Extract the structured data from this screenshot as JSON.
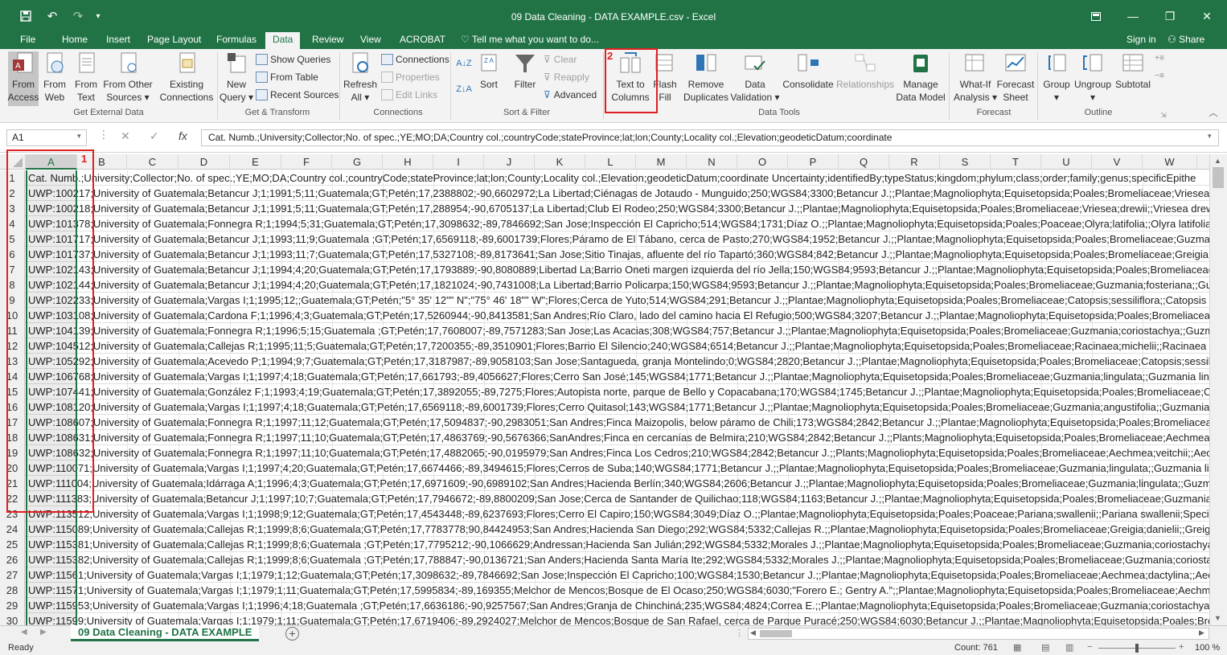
{
  "window": {
    "title": "09 Data Cleaning - DATA EXAMPLE.csv - Excel"
  },
  "tabs": [
    "File",
    "Home",
    "Insert",
    "Page Layout",
    "Formulas",
    "Data",
    "Review",
    "View",
    "ACROBAT"
  ],
  "tell_me": "Tell me what you want to do...",
  "account": {
    "sign_in": "Sign in",
    "share": "Share"
  },
  "ribbon": {
    "get_external": {
      "label": "Get External Data",
      "buttons": [
        [
          "From",
          "Access"
        ],
        [
          "From",
          "Web"
        ],
        [
          "From",
          "Text"
        ],
        [
          "From Other",
          "Sources ▾"
        ],
        [
          "Existing",
          "Connections"
        ]
      ]
    },
    "get_transform": {
      "label": "Get & Transform",
      "new_query": [
        "New",
        "Query ▾"
      ],
      "show_queries": "Show Queries",
      "from_table": "From Table",
      "recent_sources": "Recent Sources"
    },
    "connections": {
      "label": "Connections",
      "refresh": [
        "Refresh",
        "All ▾"
      ],
      "connections": "Connections",
      "properties": "Properties",
      "edit_links": "Edit Links"
    },
    "sort_filter": {
      "label": "Sort & Filter",
      "sort": "Sort",
      "filter": "Filter",
      "clear": "Clear",
      "reapply": "Reapply",
      "advanced": "Advanced"
    },
    "data_tools": {
      "label": "Data Tools",
      "text_to_columns": [
        "Text to",
        "Columns"
      ],
      "flash_fill": [
        "Flash",
        "Fill"
      ],
      "remove_duplicates": [
        "Remove",
        "Duplicates"
      ],
      "data_validation": [
        "Data",
        "Validation ▾"
      ],
      "consolidate": "Consolidate",
      "relationships": "Relationships",
      "manage_data_model": [
        "Manage",
        "Data Model"
      ]
    },
    "forecast": {
      "label": "Forecast",
      "what_if": [
        "What-If",
        "Analysis ▾"
      ],
      "forecast_sheet": [
        "Forecast",
        "Sheet"
      ]
    },
    "outline": {
      "label": "Outline",
      "group": [
        "Group",
        "▾"
      ],
      "ungroup": [
        "Ungroup",
        "▾"
      ],
      "subtotal": "Subtotal"
    }
  },
  "annotations": {
    "one": "1",
    "two": "2"
  },
  "formula_bar": {
    "name_box": "A1",
    "fx": "fx",
    "content": "Cat. Numb.;University;Collector;No. of spec.;YE;MO;DA;Country col.;countryCode;stateProvince;lat;lon;County;Locality col.;Elevation;geodeticDatum;coordinate"
  },
  "columns": [
    "A",
    "B",
    "C",
    "D",
    "E",
    "F",
    "G",
    "H",
    "I",
    "J",
    "K",
    "L",
    "M",
    "N",
    "O",
    "P",
    "Q",
    "R",
    "S",
    "T",
    "U",
    "V",
    "W"
  ],
  "rows": [
    {
      "n": "1",
      "t": "Cat. Numb.;University;Collector;No. of spec.;YE;MO;DA;Country col.;countryCode;stateProvince;lat;lon;County;Locality col.;Elevation;geodeticDatum;coordinate Uncertainty;identifiedBy;typeStatus;kingdom;phylum;class;order;family;genus;specificEpithe"
    },
    {
      "n": "2",
      "t": "UWP:100217;University of Guatemala;Betancur J;1;1991;5;11;Guatemala;GT;Petén;17,2388802;-90,6602972;La Libertad;Ciénagas de Jotaudo - Munguido;250;WGS84;3300;Betancur J.;;Plantae;Magnoliophyta;Equisetopsida;Poales;Bromeliaceae;Vriesea;d"
    },
    {
      "n": "3",
      "t": "UWP:100218;University of Guatemala;Betancur J;1;1991;5;11;Guatemala;GT;Petén;17,288954;-90,6705137;La Libertad;Club El Rodeo;250;WGS84;3300;Betancur J.;;Plantae;Magnoliophyta;Equisetopsida;Poales;Bromeliaceae;Vriesea;drewii;;Vriesea drewi"
    },
    {
      "n": "4",
      "t": "UWP:101378;University of Guatemala;Fonnegra R;1;1994;5;31;Guatemala;GT;Petén;17,3098632;-89,7846692;San Jose;Inspección El Capricho;514;WGS84;1731;Díaz O.;;Plantae;Magnoliophyta;Equisetopsida;Poales;Poaceae;Olyra;latifolia;;Olyra latifolia;S"
    },
    {
      "n": "5",
      "t": "UWP:101717;University of Guatemala;Betancur J;1;1993;11;9;Guatemala   ;GT;Petén;17,6569118;-89,6001739;Flores;Páramo de El Tábano, cerca de Pasto;270;WGS84;1952;Betancur J.;;Plantae;Magnoliophyta;Equisetopsida;Poales;Bromeliaceae;Guzman"
    },
    {
      "n": "6",
      "t": "UWP:101737;University of Guatemala;Betancur J;1;1993;11;7;Guatemala;GT;Petén;17,5327108;-89,8173641;San Jose;Sitio Tinajas, afluente del río Tapartó;360;WGS84;842;Betancur J.;;Plantae;Magnoliophyta;Equisetopsida;Poales;Bromeliaceae;Greigia;s"
    },
    {
      "n": "7",
      "t": "UWP:102143;University of Guatemala;Betancur J;1;1994;4;20;Guatemala;GT;Petén;17,1793889;-90,8080889;Libertad La;Barrio Oneti margen izquierda del río Jella;150;WGS84;9593;Betancur J.;;Plantae;Magnoliophyta;Equisetopsida;Poales;Bromeliaceae;"
    },
    {
      "n": "8",
      "t": "UWP:102144;University of Guatemala;Betancur J;1;1994;4;20;Guatemala;GT;Petén;17,1821024;-90,7431008;La Libertad;Barrio Policarpa;150;WGS84;9593;Betancur J.;;Plantae;Magnoliophyta;Equisetopsida;Poales;Bromeliaceae;Guzmania;fosteriana;;Guz"
    },
    {
      "n": "9",
      "t": "UWP:102233;University of Guatemala;Vargas I;1;1995;12;;Guatemala;GT;Petén;\"5° 35' 12\"\" N\";\"75° 46' 18\"\" W\";Flores;Cerca de Yuto;514;WGS84;291;Betancur J.;;Plantae;Magnoliophyta;Equisetopsida;Poales;Bromeliaceae;Catopsis;sessiliflora;;Catopsis s"
    },
    {
      "n": "10",
      "t": "UWP:103108;University of Guatemala;Cardona F;1;1996;4;3;Guatemala;GT;Petén;17,5260944;-90,8413581;San Andres;Río Claro, lado del camino hacia El Refugio;500;WGS84;3207;Betancur J.;;Plantae;Magnoliophyta;Equisetopsida;Poales;Bromeliaceae;G"
    },
    {
      "n": "11",
      "t": "UWP:104139;University of Guatemala;Fonnegra R;1;1996;5;15;Guatemala   ;GT;Petén;17,7608007;-89,7571283;San Jose;Las Acacias;308;WGS84;757;Betancur J.;;Plantae;Magnoliophyta;Equisetopsida;Poales;Bromeliaceae;Guzmania;coriostachya;;Guzma"
    },
    {
      "n": "12",
      "t": "UWP:104512;University of Guatemala;Callejas R;1;1995;11;5;Guatemala;GT;Petén;17,7200355;-89,3510901;Flores;Barrio El Silencio;240;WGS84;6514;Betancur J.;;Plantae;Magnoliophyta;Equisetopsida;Poales;Bromeliaceae;Racinaea;michelii;;Racinaea mi"
    },
    {
      "n": "13",
      "t": "UWP:105292;University of Guatemala;Acevedo P;1;1994;9;7;Guatemala;GT;Petén;17,3187987;-89,9058103;San Jose;Santagueda, granja Montelindo;0;WGS84;2820;Betancur J.;;Plantae;Magnoliophyta;Equisetopsida;Poales;Bromeliaceae;Catopsis;sessiliflo"
    },
    {
      "n": "14",
      "t": "UWP:106768;University of Guatemala;Vargas I;1;1997;4;18;Guatemala;GT;Petén;17,661793;-89,4056627;Flores;Cerro San José;145;WGS84;1771;Betancur J.;;Plantae;Magnoliophyta;Equisetopsida;Poales;Bromeliaceae;Guzmania;lingulata;;Guzmania lingu"
    },
    {
      "n": "15",
      "t": "UWP:107441;University of Guatemala;González F;1;1993;4;19;Guatemala;GT;Petén;17,3892055;-89,7275;Flores;Autopista norte, parque de Bello y Copacabana;170;WGS84;1745;Betancur J.;;Plantae;Magnoliophyta;Equisetopsida;Poales;Bromeliaceae;Cat"
    },
    {
      "n": "16",
      "t": "UWP:108120;University of Guatemala;Vargas I;1;1997;4;18;Guatemala;GT;Petén;17,6569118;-89,6001739;Flores;Cerro Quitasol;143;WGS84;1771;Betancur J.;;Plantae;Magnoliophyta;Equisetopsida;Poales;Bromeliaceae;Guzmania;angustifolia;;Guzmania a"
    },
    {
      "n": "17",
      "t": "UWP:108607;University of Guatemala;Fonnegra R;1;1997;11;12;Guatemala;GT;Petén;17,5094837;-90,2983051;San Andres;Finca Maizopolis, below páramo de Chili;173;WGS84;2842;Betancur J.;;Plantae;Magnoliophyta;Equisetopsida;Poales;Bromeliaceae;"
    },
    {
      "n": "18",
      "t": "UWP:108631;University of Guatemala;Fonnegra R;1;1997;11;10;Guatemala;GT;Petén;17,4863769;-90,5676366;SanAndres;Finca en cercanías de Belmira;210;WGS84;2842;Betancur J.;;Plants;Magnoliophyta;Equisetopsida;Poales;Bromeliaceae;Aechmea;ve"
    },
    {
      "n": "19",
      "t": "UWP:108632;University of Guatemala;Fonnegra R;1;1997;11;10;Guatemala;GT;Petén;17,4882065;-90,0195979;San Andres;Finca Los Cedros;210;WGS84;2842;Betancur J.;;Plants;Magnoliophyta;Equisetopsida;Poales;Bromeliaceae;Aechmea;veitchii;;Aechn"
    },
    {
      "n": "20",
      "t": "UWP:110071;University of Guatemala;Vargas I;1;1997;4;20;Guatemala;GT;Petén;17,6674466;-89,3494615;Flores;Cerros de Suba;140;WGS84;1771;Betancur J.;;Plantae;Magnoliophyta;Equisetopsida;Poales;Bromeliaceae;Guzmania;lingulata;;Guzmania ling"
    },
    {
      "n": "21",
      "t": "UWP:111004;University of Guatemala;Idárraga A;1;1996;4;3;Guatemala;GT;Petén;17,6971609;-90,6989102;San Andres;Hacienda Berlín;340;WGS84;2606;Betancur J.;;Plantae;Magnoliophyta;Equisetopsida;Poales;Bromeliaceae;Guzmania;lingulata;;Guzmai"
    },
    {
      "n": "22",
      "t": "UWP:111383;University of Guatemala;Betancur J;1;1997;10;7;Guatemala;GT;Petén;17,7946672;-89,8800209;San Jose;Cerca de Santander de Quilichao;118;WGS84;1163;Betancur J.;;Plantae;Magnoliophyta;Equisetopsida;Poales;Bromeliaceae;Guzmania;g"
    },
    {
      "n": "23",
      "t": "UWP:113512;University of Guatemala;Vargas I;1;1998;9;12;Guatemala;GT;Petén;17,4543448;-89,6237693;Flores;Cerro El Capiro;150;WGS84;3049;Díaz O.;;Plantae;Magnoliophyta;Equisetopsida;Poales;Poaceae;Pariana;swallenii;;Pariana swallenii;Species,"
    },
    {
      "n": "24",
      "t": "UWP:115089;University of Guatemala;Callejas R;1;1999;8;6;Guatemala;GT;Petén;17,7783778;90,84424953;San Andres;Hacienda San Diego;292;WGS84;5332;Callejas R.;;Plantae;Magnoliophyta;Equisetopsida;Poales;Bromeliaceae;Greigia;danielii;;Greigia d"
    },
    {
      "n": "25",
      "t": "UWP:115381;University of Guatemala;Callejas R;1;1999;8;6;Guatemala   ;GT;Petén;17,7795212;-90,1066629;Andressan;Hacienda San Julián;292;WGS84;5332;Morales J.;;Plantae;Magnoliophyta;Equisetopsida;Poales;Bromeliaceae;Guzmania;coriostachya;"
    },
    {
      "n": "26",
      "t": "UWP:115382;University of Guatemala;Callejas R;1;1999;8;6;Guatemala   ;GT;Petén;17,788847;-90,0136721;San Anders;Hacienda Santa María Ite;292;WGS84;5332;Morales J.;;Plantae;Magnoliophyta;Equisetopsida;Poales;Bromeliaceae;Guzmania;coriostac"
    },
    {
      "n": "27",
      "t": "UWP:11561;University of Guatemala;Vargas I;1;1979;1;12;Guatemala;GT;Petén;17,3098632;-89,7846692;San Jose;Inspección El Capricho;100;WGS84;1530;Betancur J.;;Plantae;Magnoliophyta;Equisetopsida;Poales;Bromeliaceae;Aechmea;dactylina;;Aech"
    },
    {
      "n": "28",
      "t": "UWP:11571;University of Guatemala;Vargas I;1;1979;1;11;Guatemala;GT;Petén;17,5995834;-89,169355;Melchor de Mencos;Bosque de El Ocaso;250;WGS84;6030;\"Forero E.; Gentry A.\";;Plantae;Magnoliophyta;Equisetopsida;Poales;Bromeliaceae;Aechme"
    },
    {
      "n": "29",
      "t": "UWP:115953;University of Guatemala;Vargas I;1;1996;4;18;Guatemala   ;GT;Petén;17,6636186;-90,9257567;San Andres;Granja de Chinchiná;235;WGS84;4824;Correa E.;;Plantae;Magnoliophyta;Equisetopsida;Poales;Bromeliaceae;Guzmania;coriostachya;;"
    },
    {
      "n": "30",
      "t": "UWP:11599;University of Guatemala;Vargas I;1;1979;1;11;Guatemala;GT;Petén;17,6719406;-89,2924027;Melchor de Mencos;Bosque de San Rafael, cerca de Parque Puracé;250;WGS84;6030;Betancur J.;;Plantae;Magnoliophyta;Equisetopsida;Poales;Brom"
    }
  ],
  "sheet_tab": "09 Data Cleaning - DATA EXAMPLE",
  "status": {
    "ready": "Ready",
    "count": "Count: 761",
    "zoom": "100 %"
  }
}
